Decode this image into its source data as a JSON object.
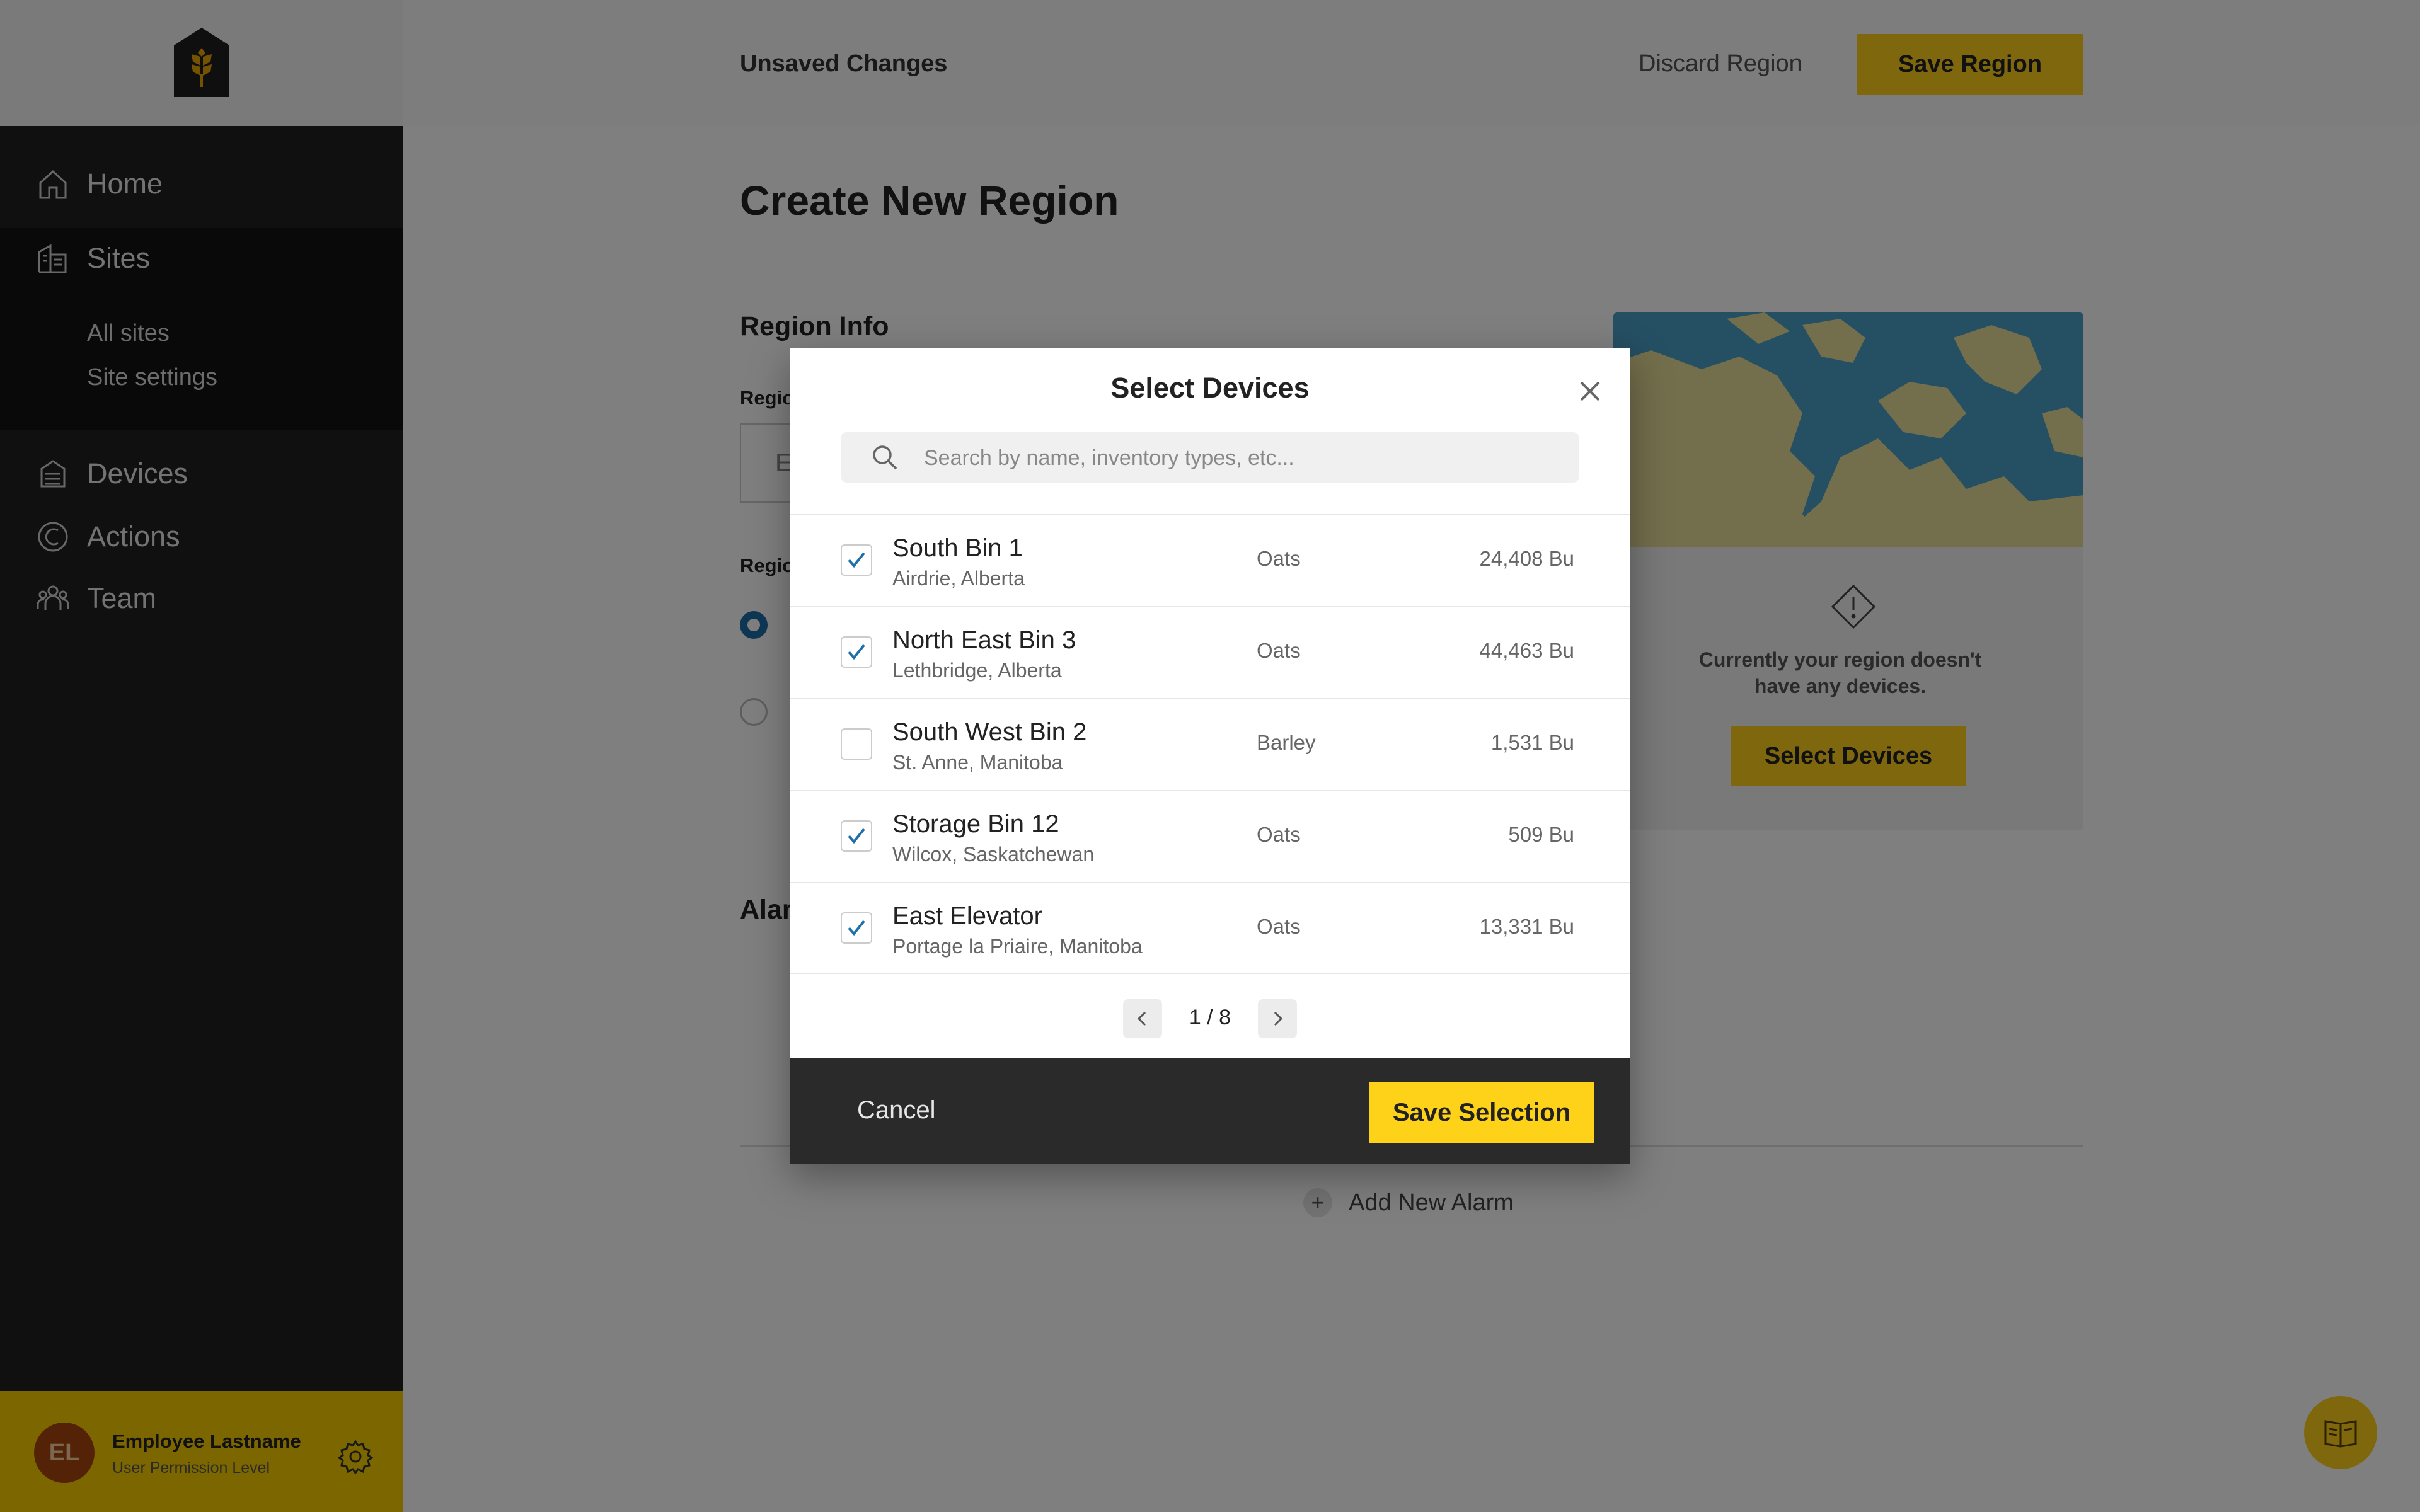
{
  "sidebar": {
    "nav": [
      {
        "label": "Home",
        "icon": "home-icon"
      },
      {
        "label": "Sites",
        "icon": "sites-icon"
      },
      {
        "label": "Devices",
        "icon": "devices-icon"
      },
      {
        "label": "Actions",
        "icon": "actions-icon"
      },
      {
        "label": "Team",
        "icon": "team-icon"
      }
    ],
    "sites_sub": [
      "All sites",
      "Site settings"
    ],
    "user": {
      "initials": "EL",
      "name": "Employee Lastname",
      "role": "User Permission Level"
    }
  },
  "topbar": {
    "status": "Unsaved Changes",
    "discard_label": "Discard Region",
    "save_label": "Save Region"
  },
  "page": {
    "title": "Create New Region",
    "section_title": "Region Info",
    "field1_label": "Regio",
    "field1_placeholder": "E",
    "field2_label": "Regio",
    "alarms_title": "Alar",
    "empty_message": "Currently your region doesn't have any devices.",
    "select_devices_label": "Select Devices",
    "add_alarm_label": "Add New Alarm"
  },
  "modal": {
    "title": "Select Devices",
    "search_placeholder": "Search by name, inventory types, etc...",
    "devices": [
      {
        "name": "South Bin 1",
        "location": "Airdrie, Alberta",
        "type": "Oats",
        "quantity": "24,408 Bu",
        "checked": true
      },
      {
        "name": "North East Bin 3",
        "location": "Lethbridge, Alberta",
        "type": "Oats",
        "quantity": "44,463 Bu",
        "checked": true
      },
      {
        "name": "South West Bin 2",
        "location": "St. Anne, Manitoba",
        "type": "Barley",
        "quantity": "1,531 Bu",
        "checked": false
      },
      {
        "name": "Storage Bin 12",
        "location": "Wilcox, Saskatchewan",
        "type": "Oats",
        "quantity": "509 Bu",
        "checked": true
      },
      {
        "name": "East Elevator",
        "location": "Portage la Priaire, Manitoba",
        "type": "Oats",
        "quantity": "13,331 Bu",
        "checked": true
      }
    ],
    "pagination": "1 / 8",
    "cancel_label": "Cancel",
    "save_label": "Save Selection"
  },
  "colors": {
    "accent_yellow": "#ffcf1a",
    "sidebar_bg": "#202020",
    "check_blue": "#1f6fa8",
    "modal_footer": "#2a2a2a"
  }
}
